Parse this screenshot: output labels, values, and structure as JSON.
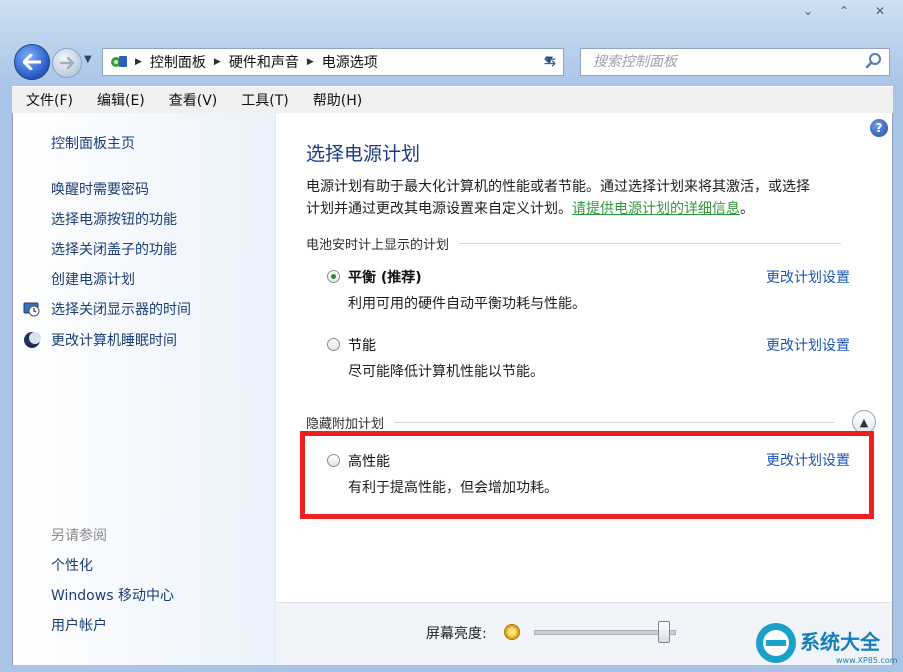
{
  "window": {
    "caption_buttons": [
      "⌄",
      "⌃",
      "✕"
    ]
  },
  "address": {
    "crumbs": [
      "控制面板",
      "硬件和声音",
      "电源选项"
    ],
    "search_placeholder": "搜索控制面板"
  },
  "menu": [
    "文件(F)",
    "编辑(E)",
    "查看(V)",
    "工具(T)",
    "帮助(H)"
  ],
  "sidebar": {
    "home": "控制面板主页",
    "links": [
      "唤醒时需要密码",
      "选择电源按钮的功能",
      "选择关闭盖子的功能",
      "创建电源计划",
      "选择关闭显示器的时间",
      "更改计算机睡眠时间"
    ],
    "see_also_title": "另请参阅",
    "see_also": [
      "个性化",
      "Windows 移动中心",
      "用户帐户"
    ]
  },
  "main": {
    "title": "选择电源计划",
    "desc_line1": "电源计划有助于最大化计算机的性能或者节能。通过选择计划来将其激活，或选择",
    "desc_line2": "计划并通过更改其电源设置来自定义计划。",
    "desc_link": "请提供电源计划的详细信息",
    "desc_end": "。",
    "group1_header": "电池安时计上显示的计划",
    "plans": [
      {
        "name": "平衡 (推荐)",
        "desc": "利用可用的硬件自动平衡功耗与性能。",
        "selected": true,
        "link": "更改计划设置"
      },
      {
        "name": "节能",
        "desc": "尽可能降低计算机性能以节能。",
        "selected": false,
        "link": "更改计划设置"
      }
    ],
    "group2_header": "隐藏附加计划",
    "hidden_plan": {
      "name": "高性能",
      "desc": "有利于提高性能，但会增加功耗。",
      "selected": false,
      "link": "更改计划设置"
    },
    "brightness_label": "屏幕亮度:",
    "brightness_level": 0.92
  },
  "watermark": {
    "text": "系统大全",
    "url": "www.XP85.com"
  },
  "colors": {
    "highlight_box": "#ee2121",
    "link": "#1c56b4",
    "title": "#1d3b86",
    "green_link": "#2f9a3c"
  }
}
